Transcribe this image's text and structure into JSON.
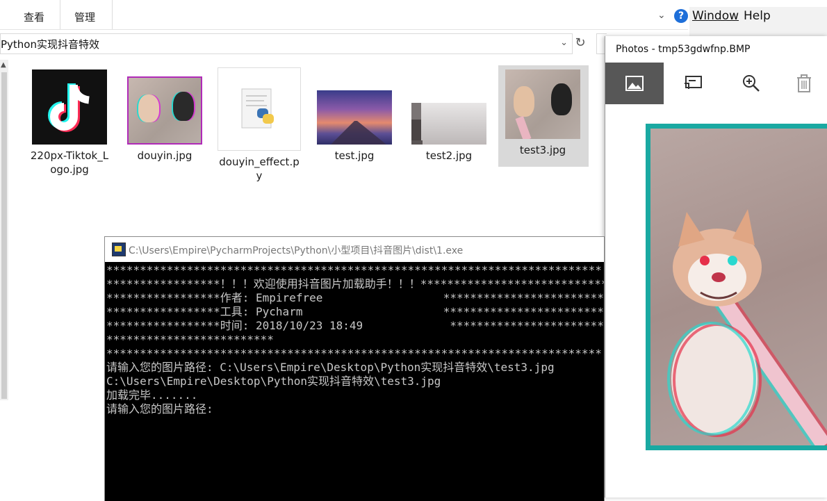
{
  "explorer": {
    "tabs": {
      "view": "查看",
      "manage": "管理"
    },
    "address": "Python实现抖音特效",
    "files": [
      {
        "name": "220px-Tiktok_Logo.jpg",
        "line1": "220px-Tiktok_L",
        "line2": "ogo.jpg"
      },
      {
        "name": "douyin.jpg",
        "line1": "douyin.jpg",
        "line2": ""
      },
      {
        "name": "douyin_effect.py",
        "line1": "douyin_effect.p",
        "line2": "y"
      },
      {
        "name": "test.jpg",
        "line1": "test.jpg",
        "line2": ""
      },
      {
        "name": "test2.jpg",
        "line1": "test2.jpg",
        "line2": ""
      },
      {
        "name": "test3.jpg",
        "line1": "test3.jpg",
        "line2": ""
      }
    ]
  },
  "ide": {
    "menu_window": "Window",
    "menu_help": "Help"
  },
  "photos": {
    "title": "Photos - tmp53gdwfnp.BMP"
  },
  "console": {
    "title": "C:\\Users\\Empire\\PycharmProjects\\Python\\小型项目\\抖音图片\\dist\\1.exe",
    "lines": [
      "**************************************************************************",
      "*****************！！！欢迎使用抖音图片加载助手！！！*****************************",
      "*****************作者: Empirefree                  ******************************",
      "*****************工具: Pycharm                     ******************************",
      "*****************时间: 2018/10/23 18:49             *****************************",
      "*************************",
      "**************************************************************************",
      "请输入您的图片路径: C:\\Users\\Empire\\Desktop\\Python实现抖音特效\\test3.jpg",
      "C:\\Users\\Empire\\Desktop\\Python实现抖音特效\\test3.jpg",
      "加载完毕.......",
      "请输入您的图片路径:"
    ]
  }
}
